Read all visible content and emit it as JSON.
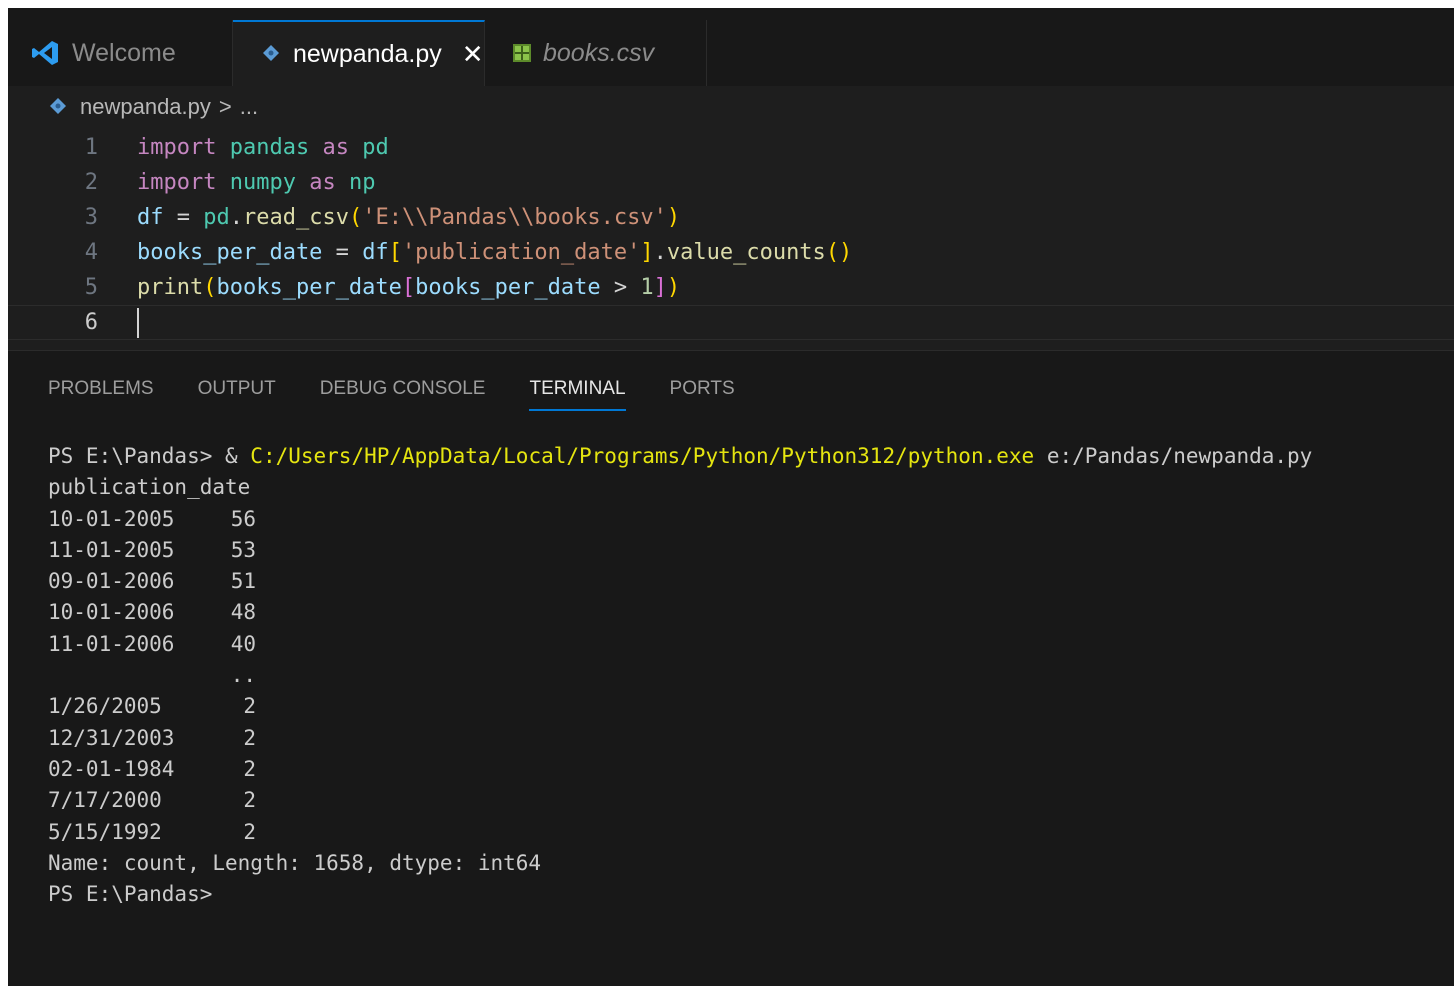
{
  "tabs": [
    {
      "label": "Welcome",
      "icon": "vscode-logo-icon"
    },
    {
      "label": "newpanda.py",
      "icon": "python-file-icon",
      "close": "✕"
    },
    {
      "label": "books.csv",
      "icon": "csv-file-icon"
    }
  ],
  "breadcrumb": {
    "file": "newpanda.py",
    "separator": ">",
    "rest": "..."
  },
  "editor": {
    "line_numbers": [
      "1",
      "2",
      "3",
      "4",
      "5",
      "6"
    ],
    "lines": [
      "import pandas as pd",
      "import numpy as np",
      "df = pd.read_csv('E:\\\\Pandas\\\\books.csv')",
      "books_per_date = df['publication_date'].value_counts()",
      "print(books_per_date[books_per_date > 1])",
      ""
    ]
  },
  "panel": {
    "tabs": [
      "PROBLEMS",
      "OUTPUT",
      "DEBUG CONSOLE",
      "TERMINAL",
      "PORTS"
    ],
    "active_tab": "TERMINAL"
  },
  "terminal": {
    "prompt": "PS E:\\Pandas> & ",
    "exe_path": "C:/Users/HP/AppData/Local/Programs/Python/Python312/python.exe",
    "script_arg": " e:/Pandas/newpanda.py",
    "header": "publication_date",
    "rows": [
      {
        "date": "10-01-2005",
        "count": "56"
      },
      {
        "date": "11-01-2005",
        "count": "53"
      },
      {
        "date": "09-01-2006",
        "count": "51"
      },
      {
        "date": "10-01-2006",
        "count": "48"
      },
      {
        "date": "11-01-2006",
        "count": "40"
      },
      {
        "date": "",
        "count": ".."
      },
      {
        "date": "1/26/2005",
        "count": "2"
      },
      {
        "date": "12/31/2003",
        "count": "2"
      },
      {
        "date": "02-01-1984",
        "count": "2"
      },
      {
        "date": "7/17/2000",
        "count": "2"
      },
      {
        "date": "5/15/1992",
        "count": "2"
      }
    ],
    "footer": "Name: count, Length: 1658, dtype: int64",
    "final_prompt": "PS E:\\Pandas>"
  },
  "colors": {
    "editor_bg": "#1e1e1e",
    "panel_bg": "#181818",
    "accent": "#0078d4",
    "keyword": "#c586c0",
    "string": "#ce9178",
    "terminal_path": "#e5e510"
  }
}
